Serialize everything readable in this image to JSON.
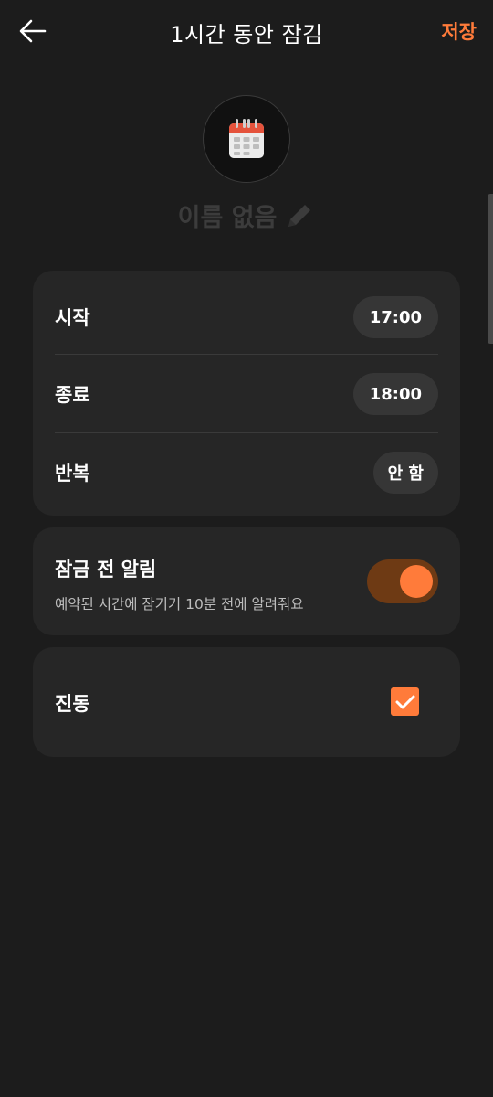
{
  "header": {
    "title": "1시간 동안 잠김",
    "save_label": "저장",
    "back_icon": "arrow-left-icon"
  },
  "profile": {
    "avatar_icon": "calendar-icon",
    "name": "이름 없음",
    "edit_icon": "pencil-icon"
  },
  "schedule": {
    "start": {
      "label": "시작",
      "value": "17:00"
    },
    "end": {
      "label": "종료",
      "value": "18:00"
    },
    "repeat": {
      "label": "반복",
      "value": "안 함"
    }
  },
  "pre_lock_alert": {
    "title": "잠금 전 알림",
    "description": "예약된 시간에 잠기기 10분 전에 알려줘요",
    "enabled": true
  },
  "vibration": {
    "label": "진동",
    "checked": true
  },
  "colors": {
    "background": "#1c1c1c",
    "card": "#262626",
    "accent": "#ff7b3a",
    "toggle_track": "#6e3a14"
  }
}
